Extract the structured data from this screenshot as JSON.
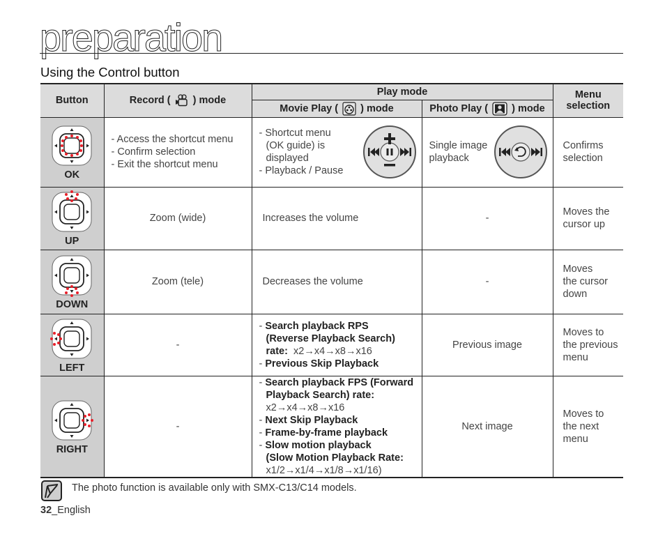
{
  "header": {
    "section": "preparation",
    "subtitle": "Using the Control button"
  },
  "table": {
    "headers": {
      "button": "Button",
      "record_pre": "Record (",
      "record_post": ") mode",
      "record_icon": "movie-camera-icon",
      "play_mode": "Play mode",
      "movie_play_pre": "Movie Play (",
      "movie_play_post": ") mode",
      "movie_play_icon": "film-reel-icon",
      "photo_play_pre": "Photo Play (",
      "photo_play_post": ") mode",
      "photo_play_icon": "photo-person-icon",
      "menu_selection_1": "Menu",
      "menu_selection_2": "selection"
    },
    "rows": [
      {
        "button": "OK",
        "highlight": "center",
        "record": [
          "- Access the shortcut menu",
          "- Confirm selection",
          "- Exit the shortcut menu"
        ],
        "movie": [
          "- Shortcut menu",
          "(OK guide) is",
          "displayed",
          "- Playback / Pause"
        ],
        "movie_dial": {
          "top": "+",
          "bottom": "−",
          "left": "⏮",
          "center": "pause",
          "right": "⏭"
        },
        "photo": [
          "Single image",
          "playback"
        ],
        "photo_dial": {
          "left": "⏮",
          "center": "return",
          "right": "⏭"
        },
        "menu": [
          "Confirms",
          "selection"
        ]
      },
      {
        "button": "UP",
        "highlight": "up",
        "record": "Zoom (wide)",
        "movie": "Increases the volume",
        "photo": "-",
        "menu": [
          "Moves the",
          "cursor up"
        ]
      },
      {
        "button": "DOWN",
        "highlight": "down",
        "record": "Zoom (tele)",
        "movie": "Decreases the volume",
        "photo": "-",
        "menu": [
          "Moves",
          "the cursor",
          "down"
        ]
      },
      {
        "button": "LEFT",
        "highlight": "left",
        "record": "-",
        "movie": {
          "l1_dash": "- ",
          "l1": "Search playback RPS",
          "l2": "(Reverse Playback Search)",
          "l3_bold": "rate:",
          "l3_rate": "x2→x4→x8→x16",
          "l4_dash": "- ",
          "l4": "Previous Skip Playback"
        },
        "photo": "Previous image",
        "menu": [
          "Moves to",
          "the previous",
          "menu"
        ]
      },
      {
        "button": "RIGHT",
        "highlight": "right",
        "record": "-",
        "movie": {
          "l1_dash": "- ",
          "l1": "Search playback FPS (Forward",
          "l2": "Playback Search) rate:",
          "l3_rate": "x2→x4→x8→x16",
          "l4_dash": "- ",
          "l4": "Next Skip Playback",
          "l5_dash": "- ",
          "l5": "Frame-by-frame playback",
          "l6_dash": "- ",
          "l6": "Slow motion playback",
          "l7": "(Slow Motion Playback Rate:",
          "l8_rate": "x1/2→x1/4→x1/8→x1/16)"
        },
        "photo": "Next image",
        "menu": [
          "Moves to",
          "the next",
          "menu"
        ]
      }
    ]
  },
  "note": {
    "icon": "note-pencil-icon",
    "text": "The photo function is available only with SMX-C13/C14 models."
  },
  "footer": {
    "page_number": "32",
    "language": "_English"
  },
  "colors": {
    "highlight_dots": "#e8202a",
    "header_bg": "#dcdcdc",
    "button_cell_bg": "#cfcfcf"
  }
}
